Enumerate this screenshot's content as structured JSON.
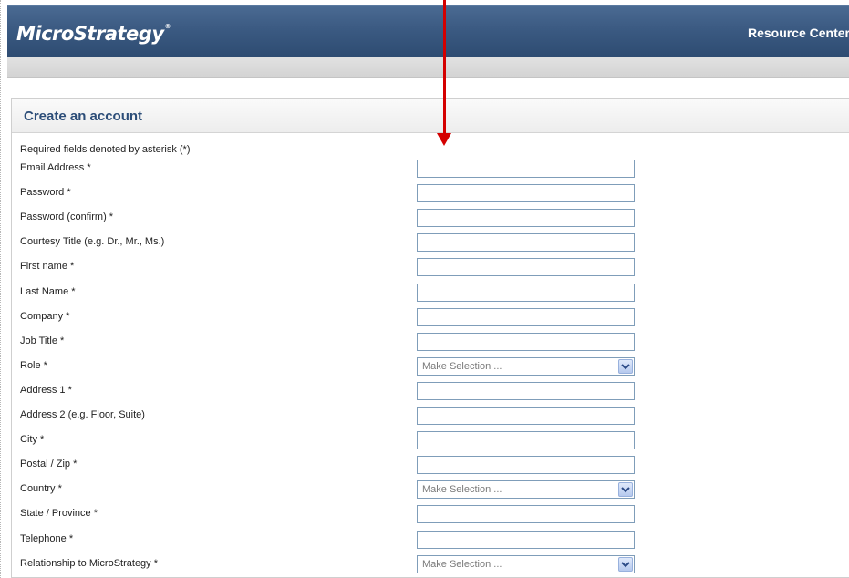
{
  "header": {
    "logo": "MicroStrategy",
    "logo_tm": "®",
    "link": "Resource Center"
  },
  "form": {
    "title": "Create an account",
    "required_note": "Required fields denoted by asterisk (*)",
    "fields": [
      {
        "label": "Email Address *",
        "type": "text",
        "value": ""
      },
      {
        "label": "Password *",
        "type": "password",
        "value": ""
      },
      {
        "label": "Password (confirm) *",
        "type": "password",
        "value": ""
      },
      {
        "label": "Courtesy Title (e.g. Dr., Mr., Ms.)",
        "type": "text",
        "value": ""
      },
      {
        "label": "First name *",
        "type": "text",
        "value": ""
      },
      {
        "label": "Last Name *",
        "type": "text",
        "value": ""
      },
      {
        "label": "Company *",
        "type": "text",
        "value": ""
      },
      {
        "label": "Job Title *",
        "type": "text",
        "value": ""
      },
      {
        "label": "Role *",
        "type": "select",
        "value": "Make Selection ..."
      },
      {
        "label": "Address 1 *",
        "type": "text",
        "value": ""
      },
      {
        "label": "Address 2 (e.g. Floor, Suite)",
        "type": "text",
        "value": ""
      },
      {
        "label": "City *",
        "type": "text",
        "value": ""
      },
      {
        "label": "Postal / Zip *",
        "type": "text",
        "value": ""
      },
      {
        "label": "Country *",
        "type": "select",
        "value": "Make Selection ..."
      },
      {
        "label": "State / Province *",
        "type": "text",
        "value": ""
      },
      {
        "label": "Telephone *",
        "type": "text",
        "value": ""
      },
      {
        "label": "Relationship to MicroStrategy *",
        "type": "select",
        "value": "Make Selection ..."
      }
    ]
  },
  "colors": {
    "header_bg": "#3b5a82",
    "title_text": "#2c4d78",
    "annotation_arrow": "#d40000",
    "input_border": "#7f9db9"
  },
  "icons": {
    "annotation": "red-arrow-icon",
    "dropdown": "chevron-down-icon"
  }
}
